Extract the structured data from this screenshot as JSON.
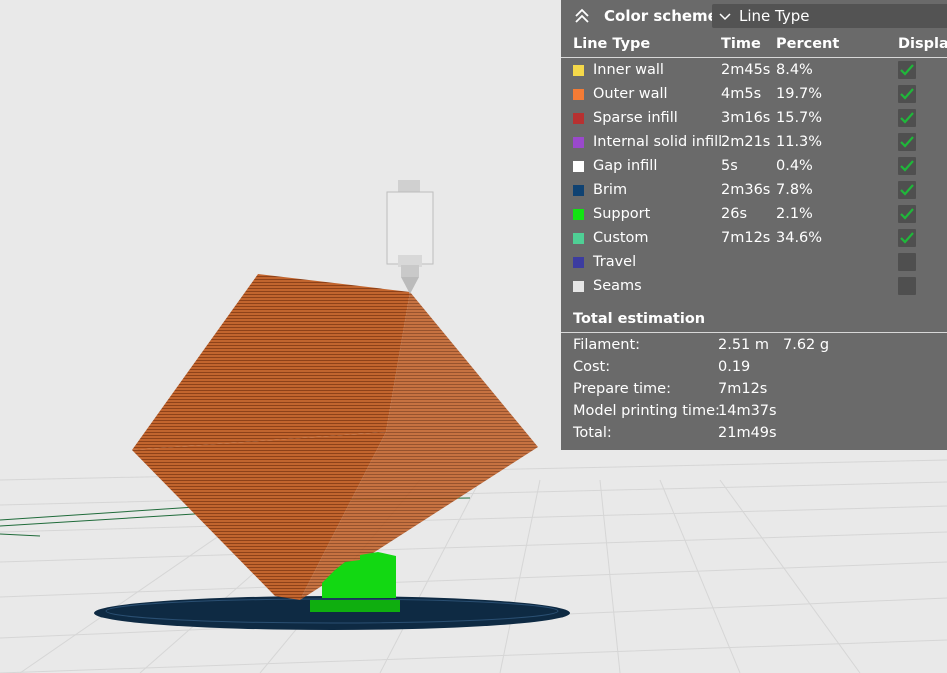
{
  "color_scheme": {
    "title": "Color scheme",
    "selected": "Line Type"
  },
  "legend": {
    "columns": {
      "line_type": "Line Type",
      "time": "Time",
      "percent": "Percent",
      "display": "Display"
    },
    "rows": [
      {
        "name": "Inner wall",
        "time": "2m45s",
        "percent": "8.4%",
        "color": "#f5d94a",
        "checked": true
      },
      {
        "name": "Outer wall",
        "time": "4m5s",
        "percent": "19.7%",
        "color": "#f47b34",
        "checked": true
      },
      {
        "name": "Sparse infill",
        "time": "3m16s",
        "percent": "15.7%",
        "color": "#b73131",
        "checked": true
      },
      {
        "name": "Internal solid infill",
        "time": "2m21s",
        "percent": "11.3%",
        "color": "#9a49cc",
        "checked": true
      },
      {
        "name": "Gap infill",
        "time": "5s",
        "percent": "0.4%",
        "color": "#ffffff",
        "checked": true
      },
      {
        "name": "Brim",
        "time": "2m36s",
        "percent": "7.8%",
        "color": "#0f4272",
        "checked": true
      },
      {
        "name": "Support",
        "time": "26s",
        "percent": "2.1%",
        "color": "#12e312",
        "checked": true
      },
      {
        "name": "Custom",
        "time": "7m12s",
        "percent": "34.6%",
        "color": "#4fcf95",
        "checked": true
      },
      {
        "name": "Travel",
        "time": "",
        "percent": "",
        "color": "#3c3ca0",
        "checked": false
      },
      {
        "name": "Seams",
        "time": "",
        "percent": "",
        "color": "#e6e6e6",
        "checked": false
      }
    ]
  },
  "estimation": {
    "title": "Total estimation",
    "filament_label": "Filament:",
    "filament_length": "2.51 m",
    "filament_weight": "7.62 g",
    "cost_label": "Cost:",
    "cost": "0.19",
    "prepare_label": "Prepare time:",
    "prepare": "7m12s",
    "model_label": "Model printing time:",
    "model": "14m37s",
    "total_label": "Total:",
    "total": "21m49s"
  }
}
